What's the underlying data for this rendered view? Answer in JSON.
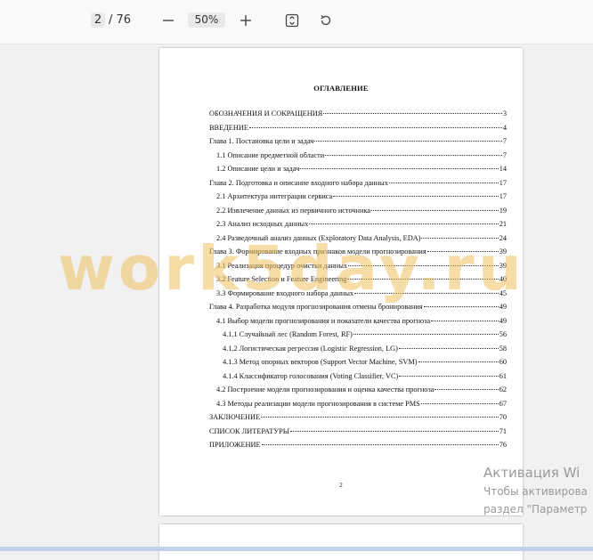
{
  "toolbar": {
    "page_current": "2",
    "page_total": "/ 76",
    "zoom": "50%",
    "icons": [
      "minus-icon",
      "plus-icon",
      "fit-page-icon",
      "rotate-icon"
    ]
  },
  "document": {
    "toc_title": "ОГЛАВЛЕНИЕ",
    "entries": [
      {
        "text": "ОБОЗНАЧЕНИЯ И СОКРАЩЕНИЯ",
        "page": "3",
        "level": 1
      },
      {
        "text": "ВВЕДЕНИЕ",
        "page": "4",
        "level": 1
      },
      {
        "text": "Глава 1. Постановка цели и задач",
        "page": "7",
        "level": 1
      },
      {
        "text": "1.1 Описание предметной области",
        "page": "7",
        "level": 2
      },
      {
        "text": "1.2 Описание цели и задач",
        "page": "14",
        "level": 2
      },
      {
        "text": "Глава 2. Подготовка и описание входного набора данных",
        "page": "17",
        "level": 1
      },
      {
        "text": "2.1 Архитектура интеграции сервиса",
        "page": "17",
        "level": 2
      },
      {
        "text": "2.2 Извлечение данных из первичного источника",
        "page": "19",
        "level": 2
      },
      {
        "text": "2.3 Анализ исходных данных",
        "page": "21",
        "level": 2
      },
      {
        "text": "2.4 Разведочный анализ данных (Exploratory Data Analysis, EDA)",
        "page": "24",
        "level": 2
      },
      {
        "text": "Глава 3. Формирование входных признаков модели прогнозирования",
        "page": "39",
        "level": 1
      },
      {
        "text": "3.1 Реализация процедур очистки данных",
        "page": "39",
        "level": 2
      },
      {
        "text": "3.2 Feature Selection и Feature Engineering",
        "page": "40",
        "level": 2
      },
      {
        "text": "3.3 Формирование входного набора данных",
        "page": "45",
        "level": 2
      },
      {
        "text": "Глава 4. Разработка модуля прогнозирования отмены бронирования",
        "page": "49",
        "level": 1
      },
      {
        "text": "4.1 Выбор модели прогнозирования и показатели качества прогноза",
        "page": "49",
        "level": 2
      },
      {
        "text": "4.1.1 Случайный лес (Random Forest, RF)",
        "page": "56",
        "level": 3
      },
      {
        "text": "4.1.2 Логистическая регрессия (Logistic Regression, LG)",
        "page": "58",
        "level": 3
      },
      {
        "text": "4.1.3 Метод опорных векторов (Support Vector Machine, SVM)",
        "page": "60",
        "level": 3
      },
      {
        "text": "4.1.4 Классификатор голосования (Voting Classifier, VC)",
        "page": "61",
        "level": 3
      },
      {
        "text": "4.2 Построение модели прогнозирования и оценка качества прогноза",
        "page": "62",
        "level": 2
      },
      {
        "text": "4.3 Методы реализации модели прогнозирования в системе PMS",
        "page": "67",
        "level": 2
      },
      {
        "text": "ЗАКЛЮЧЕНИЕ",
        "page": "70",
        "level": 1
      },
      {
        "text": "СПИСОК ЛИТЕРАТУРЫ",
        "page": "71",
        "level": 1
      },
      {
        "text": "ПРИЛОЖЕНИЕ",
        "page": "76",
        "level": 1
      }
    ],
    "footer_page_number": "2"
  },
  "watermark": "work5day.ru",
  "activation": {
    "line1": "Активация Wi",
    "line2": "Чтобы активирова",
    "line3": "раздел \"Параметр"
  }
}
